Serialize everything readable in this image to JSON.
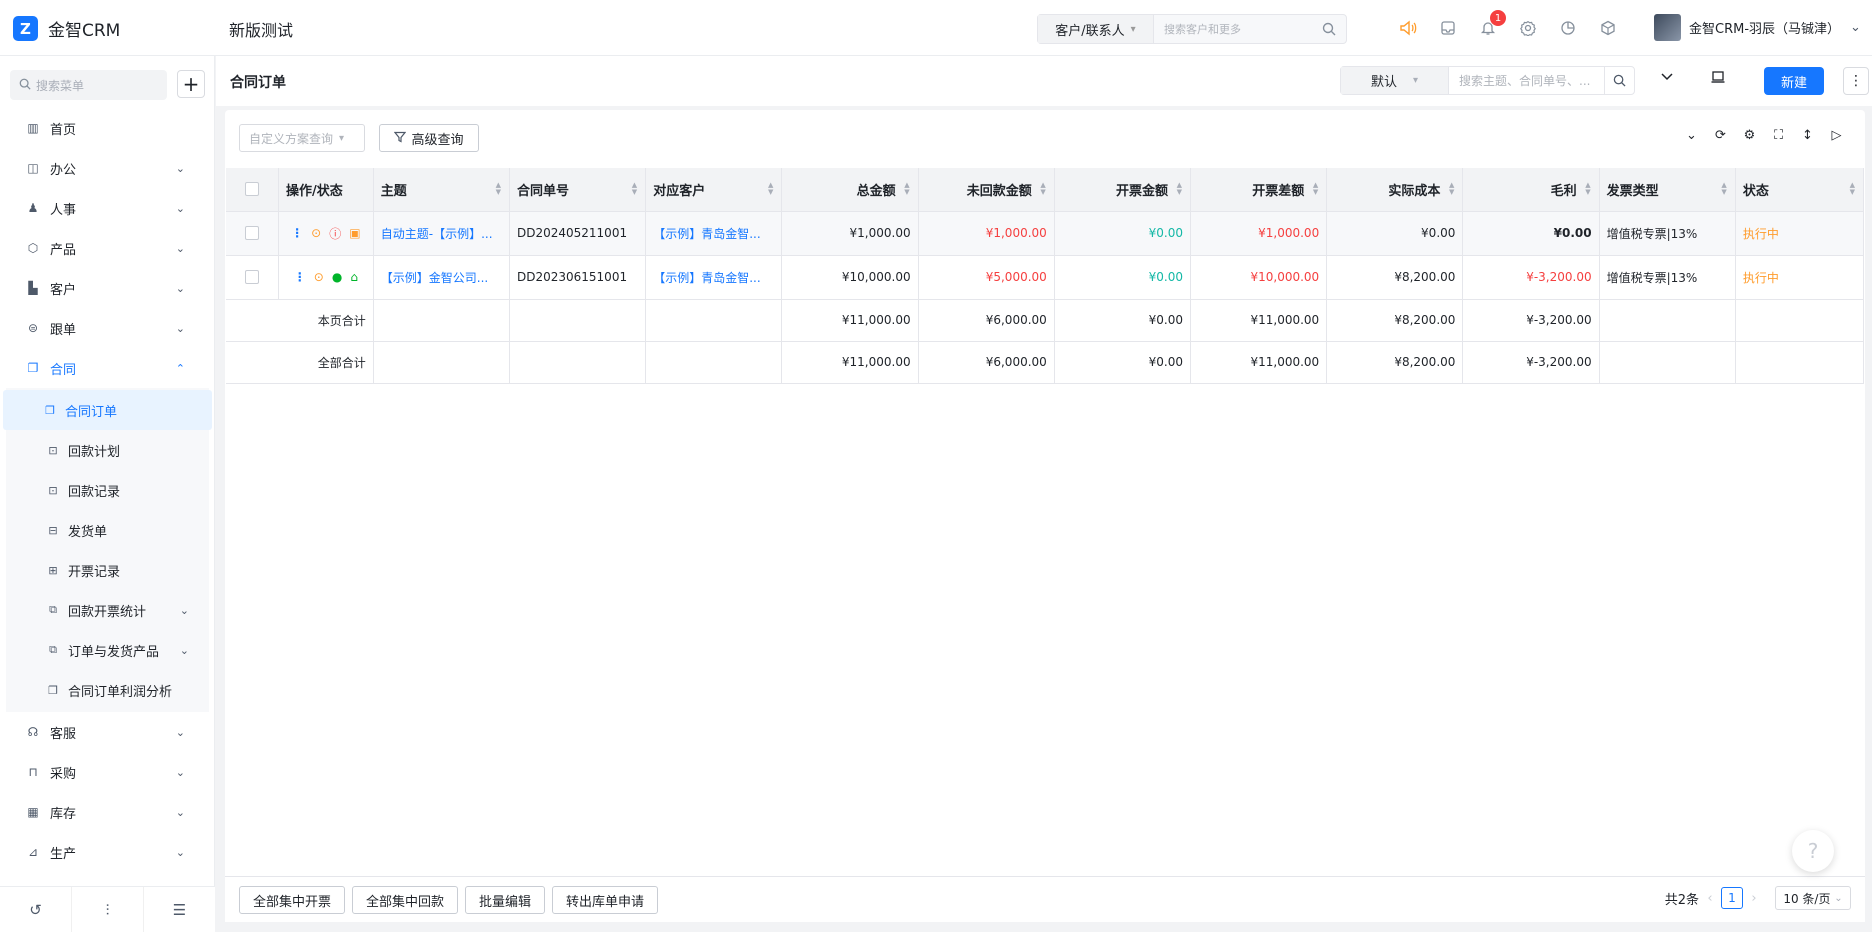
{
  "app": {
    "logo_mark": "Z",
    "name": "金智CRM",
    "project": "新版测试"
  },
  "global_search": {
    "scope": "客户/联系人",
    "placeholder": "搜索客户和更多"
  },
  "top_icons": {
    "notification_count": "1"
  },
  "user": {
    "name": "金智CRM-羽辰（马铖津）"
  },
  "sidebar": {
    "search_placeholder": "搜索菜单",
    "add": "+",
    "items": [
      {
        "label": "首页",
        "icon": "home-icon"
      },
      {
        "label": "办公",
        "icon": "office-icon"
      },
      {
        "label": "人事",
        "icon": "people-icon"
      },
      {
        "label": "产品",
        "icon": "box-icon"
      },
      {
        "label": "客户",
        "icon": "building-icon"
      },
      {
        "label": "跟单",
        "icon": "follow-icon"
      },
      {
        "label": "合同",
        "icon": "contract-icon"
      }
    ],
    "contract_children": [
      {
        "label": "合同订单",
        "active": true
      },
      {
        "label": "回款计划"
      },
      {
        "label": "回款记录"
      },
      {
        "label": "发货单"
      },
      {
        "label": "开票记录"
      },
      {
        "label": "回款开票统计"
      },
      {
        "label": "订单与发货产品"
      },
      {
        "label": "合同订单利润分析"
      }
    ],
    "items_after": [
      {
        "label": "客服"
      },
      {
        "label": "采购"
      },
      {
        "label": "库存"
      },
      {
        "label": "生产"
      }
    ]
  },
  "page": {
    "title": "合同订单",
    "view_select": "默认",
    "search_placeholder": "搜索主题、合同单号、...",
    "new_button": "新建",
    "more_button": "⋮"
  },
  "toolbar": {
    "custom_query_placeholder": "自定义方案查询",
    "advanced_query": "高级查询"
  },
  "table": {
    "headers": [
      "操作/状态",
      "主题",
      "合同单号",
      "对应客户",
      "总金额",
      "未回款金额",
      "开票金额",
      "开票差额",
      "实际成本",
      "毛利",
      "发票类型",
      "状态"
    ],
    "rows": [
      {
        "subject": "自动主题-【示例】...",
        "number": "DD202405211001",
        "customer": "【示例】青岛金智...",
        "total": "¥1,000.00",
        "unpaid": "¥1,000.00",
        "invoiced": "¥0.00",
        "invoice_diff": "¥1,000.00",
        "cost": "¥0.00",
        "profit": "¥0.00",
        "invoice_type": "增值税专票|13%",
        "status": "执行中"
      },
      {
        "subject": "【示例】金智公司...",
        "number": "DD202306151001",
        "customer": "【示例】青岛金智...",
        "total": "¥10,000.00",
        "unpaid": "¥5,000.00",
        "invoiced": "¥0.00",
        "invoice_diff": "¥10,000.00",
        "cost": "¥8,200.00",
        "profit": "¥-3,200.00",
        "invoice_type": "增值税专票|13%",
        "status": "执行中"
      }
    ],
    "page_total": {
      "label": "本页合计",
      "total": "¥11,000.00",
      "unpaid": "¥6,000.00",
      "invoiced": "¥0.00",
      "invoice_diff": "¥11,000.00",
      "cost": "¥8,200.00",
      "profit": "¥-3,200.00"
    },
    "all_total": {
      "label": "全部合计",
      "total": "¥11,000.00",
      "unpaid": "¥6,000.00",
      "invoiced": "¥0.00",
      "invoice_diff": "¥11,000.00",
      "cost": "¥8,200.00",
      "profit": "¥-3,200.00"
    }
  },
  "footer": {
    "buttons": [
      "全部集中开票",
      "全部集中回款",
      "批量编辑",
      "转出库单申请"
    ],
    "count": "共2条",
    "current_page": "1",
    "page_size": "10 条/页"
  },
  "colors": {
    "accent": "#1677ff",
    "danger": "#f53f3f",
    "success": "#14b8a6",
    "warning": "#ff9c2c"
  }
}
